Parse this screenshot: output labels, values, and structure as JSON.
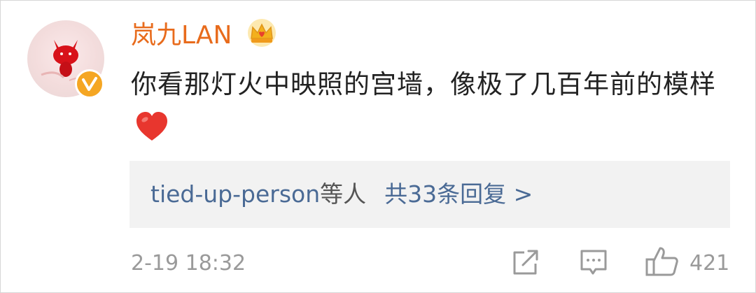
{
  "comment": {
    "user": {
      "name": "岚九LAN",
      "badge_icon": "crown-icon",
      "verified_icon": "verified-v-icon",
      "avatar_icon": "fox-avatar"
    },
    "text": "你看那灯火中映照的宫墙，像极了几百年前的模样",
    "emoji": "heart-emoji",
    "replies": {
      "users": "tied-up-person",
      "suffix": "等人",
      "link": "共33条回复 >"
    },
    "timestamp": "2-19 18:32",
    "actions": {
      "share_icon": "share-icon",
      "comment_icon": "comment-icon",
      "like_icon": "thumbs-up-icon",
      "like_count": "421"
    }
  },
  "colors": {
    "username": "#e86b1c",
    "link": "#4a6a95",
    "muted": "#9a9a9a",
    "replies_bg": "#f2f2f2",
    "verified": "#f5a623"
  }
}
